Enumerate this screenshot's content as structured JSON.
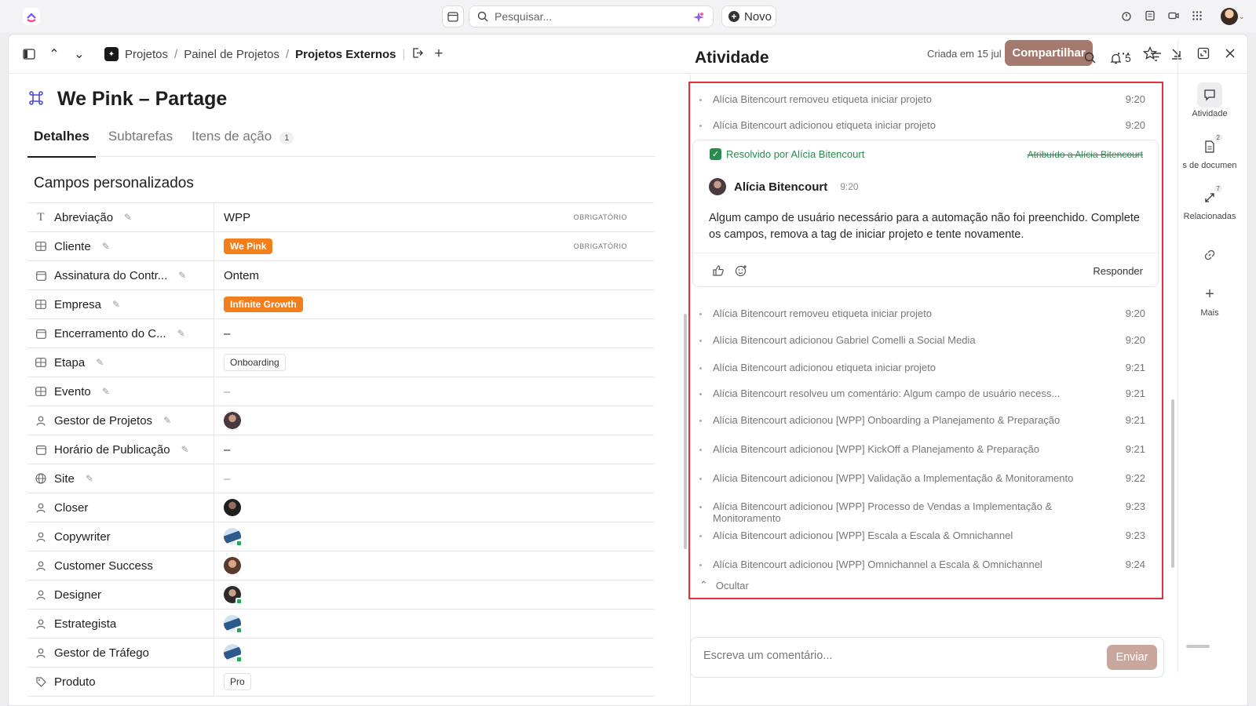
{
  "search": {
    "placeholder": "Pesquisar..."
  },
  "new_button": "Novo",
  "breadcrumb": [
    "Projetos",
    "Painel de Projetos",
    "Projetos Externos"
  ],
  "created": "Criada em 15 jul",
  "share_label": "Compartilhar",
  "task": {
    "title": "We Pink – Partage",
    "tabs": [
      {
        "label": "Detalhes"
      },
      {
        "label": "Subtarefas"
      },
      {
        "label": "Itens de ação",
        "count": "1"
      }
    ]
  },
  "custom_fields": {
    "title": "Campos personalizados",
    "required_label": "OBRIGATÓRIO",
    "rows": [
      {
        "name": "Abreviação",
        "icon": "text-icon",
        "value": "WPP"
      },
      {
        "name": "Cliente",
        "icon": "dropdown-icon",
        "value": "We Pink"
      },
      {
        "name": "Assinatura do Contr...",
        "icon": "calendar-icon",
        "value": "Ontem"
      },
      {
        "name": "Empresa",
        "icon": "dropdown-icon",
        "value": "Infinite Growth"
      },
      {
        "name": "Encerramento do C...",
        "icon": "calendar-icon",
        "value": "–"
      },
      {
        "name": "Etapa",
        "icon": "dropdown-icon",
        "value": "Onboarding"
      },
      {
        "name": "Evento",
        "icon": "dropdown-icon",
        "value": "–"
      },
      {
        "name": "Gestor de Projetos",
        "icon": "person-icon"
      },
      {
        "name": "Horário de Publicação",
        "icon": "calendar-icon",
        "value": "–"
      },
      {
        "name": "Site",
        "icon": "globe-icon",
        "value": "–"
      },
      {
        "name": "Closer",
        "icon": "person-icon"
      },
      {
        "name": "Copywriter",
        "icon": "person-icon"
      },
      {
        "name": "Customer Success",
        "icon": "person-icon"
      },
      {
        "name": "Designer",
        "icon": "person-icon"
      },
      {
        "name": "Estrategista",
        "icon": "person-icon"
      },
      {
        "name": "Gestor de Tráfego",
        "icon": "person-icon"
      },
      {
        "name": "Produto",
        "icon": "tag-icon",
        "value": "Pro"
      }
    ]
  },
  "activity": {
    "title": "Atividade",
    "notification_count": "5",
    "events_top": [
      {
        "text": "Alícia Bitencourt removeu etiqueta iniciar projeto",
        "time": "9:20"
      },
      {
        "text": "Alícia Bitencourt adicionou etiqueta iniciar projeto",
        "time": "9:20"
      }
    ],
    "comment": {
      "resolved": "Resolvido por Alícia Bitencourt",
      "assigned": "Atribuído a Alícia Bitencourt",
      "author": "Alícia Bitencourt",
      "time": "9:20",
      "text": "Algum campo de usuário necessário para a automação não foi preenchido. Complete os campos, remova a tag de iniciar projeto e tente novamente.",
      "reply": "Responder"
    },
    "events": [
      {
        "text": "Alícia Bitencourt removeu etiqueta iniciar projeto",
        "time": "9:20"
      },
      {
        "text": "Alícia Bitencourt adicionou Gabriel Comelli a Social Media",
        "time": "9:20"
      },
      {
        "text": "Alícia Bitencourt adicionou etiqueta iniciar projeto",
        "time": "9:21"
      },
      {
        "text": "Alícia Bitencourt resolveu um comentário: Algum campo de usuário necess...",
        "time": "9:21"
      },
      {
        "text": "Alícia Bitencourt adicionou [WPP] Onboarding a Planejamento & Preparação",
        "time": "9:21"
      },
      {
        "text": "Alícia Bitencourt adicionou [WPP] KickOff a Planejamento & Preparação",
        "time": "9:21"
      },
      {
        "text": "Alícia Bitencourt adicionou [WPP] Validação a Implementação & Monitoramento",
        "time": "9:22"
      },
      {
        "text": "Alícia Bitencourt adicionou [WPP] Processo de Vendas a Implementação & Monitoramento",
        "time": "9:23"
      },
      {
        "text": "Alícia Bitencourt adicionou [WPP] Escala a Escala & Omnichannel",
        "time": "9:23"
      },
      {
        "text": "Alícia Bitencourt adicionou [WPP] Omnichannel a Escala & Omnichannel",
        "time": "9:24"
      }
    ],
    "hide_label": "Ocultar",
    "comment_placeholder": "Escreva um comentário...",
    "send_label": "Enviar"
  },
  "rail": [
    {
      "label": "Atividade"
    },
    {
      "label": "s de documen",
      "count": "2"
    },
    {
      "label": "Relacionadas",
      "count": "7"
    },
    {
      "label": ""
    },
    {
      "label": "Mais"
    }
  ]
}
